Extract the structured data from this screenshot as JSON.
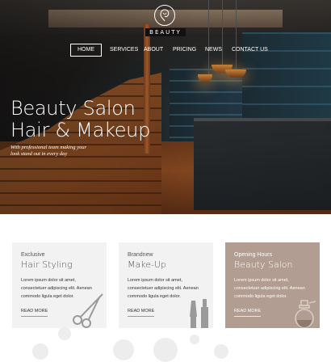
{
  "brand": {
    "name": "BEAUTY"
  },
  "nav": {
    "items": [
      {
        "label": "HOME",
        "active": true
      },
      {
        "label": "SERVICES",
        "active": false
      },
      {
        "label": "ABOUT",
        "active": false
      },
      {
        "label": "PRICING",
        "active": false
      },
      {
        "label": "NEWS",
        "active": false
      },
      {
        "label": "CONTACT US",
        "active": false
      }
    ]
  },
  "hero": {
    "title_line1": "Beauty Salon",
    "title_line2": "Hair & Makeup",
    "subtitle_line1": "With professional team making your",
    "subtitle_line2": "look stand out in every day"
  },
  "cards": [
    {
      "eyebrow": "Exclusive",
      "title": "Hair Styling",
      "body_line1": "Lorem ipsum dolor sit amet,",
      "body_line2": "consectetuer adipiscing elit. Aenean",
      "body_line3": "commodo ligula eget dolor.",
      "link": "READ MORE",
      "icon": "scissors-icon"
    },
    {
      "eyebrow": "Brandnew",
      "title": "Make-Up",
      "body_line1": "Lorem ipsum dolor sit amet,",
      "body_line2": "consectetuer adipiscing elit. Aenean",
      "body_line3": "commodo ligula eget dolor.",
      "link": "READ MORE",
      "icon": "makeup-brush-icon"
    },
    {
      "eyebrow": "Opening Hours",
      "title": "Beauty Salon",
      "body_line1": "Lorem ipsum dolor sit amet,",
      "body_line2": "consectetuer adipiscing elit. Aenean",
      "body_line3": "commodo ligula eget dolor.",
      "link": "READ MORE",
      "icon": "perfume-bottle-icon"
    }
  ],
  "colors": {
    "accent_card": "#b19d91",
    "card_bg": "#f2f2f2",
    "text_dark": "#333333"
  }
}
